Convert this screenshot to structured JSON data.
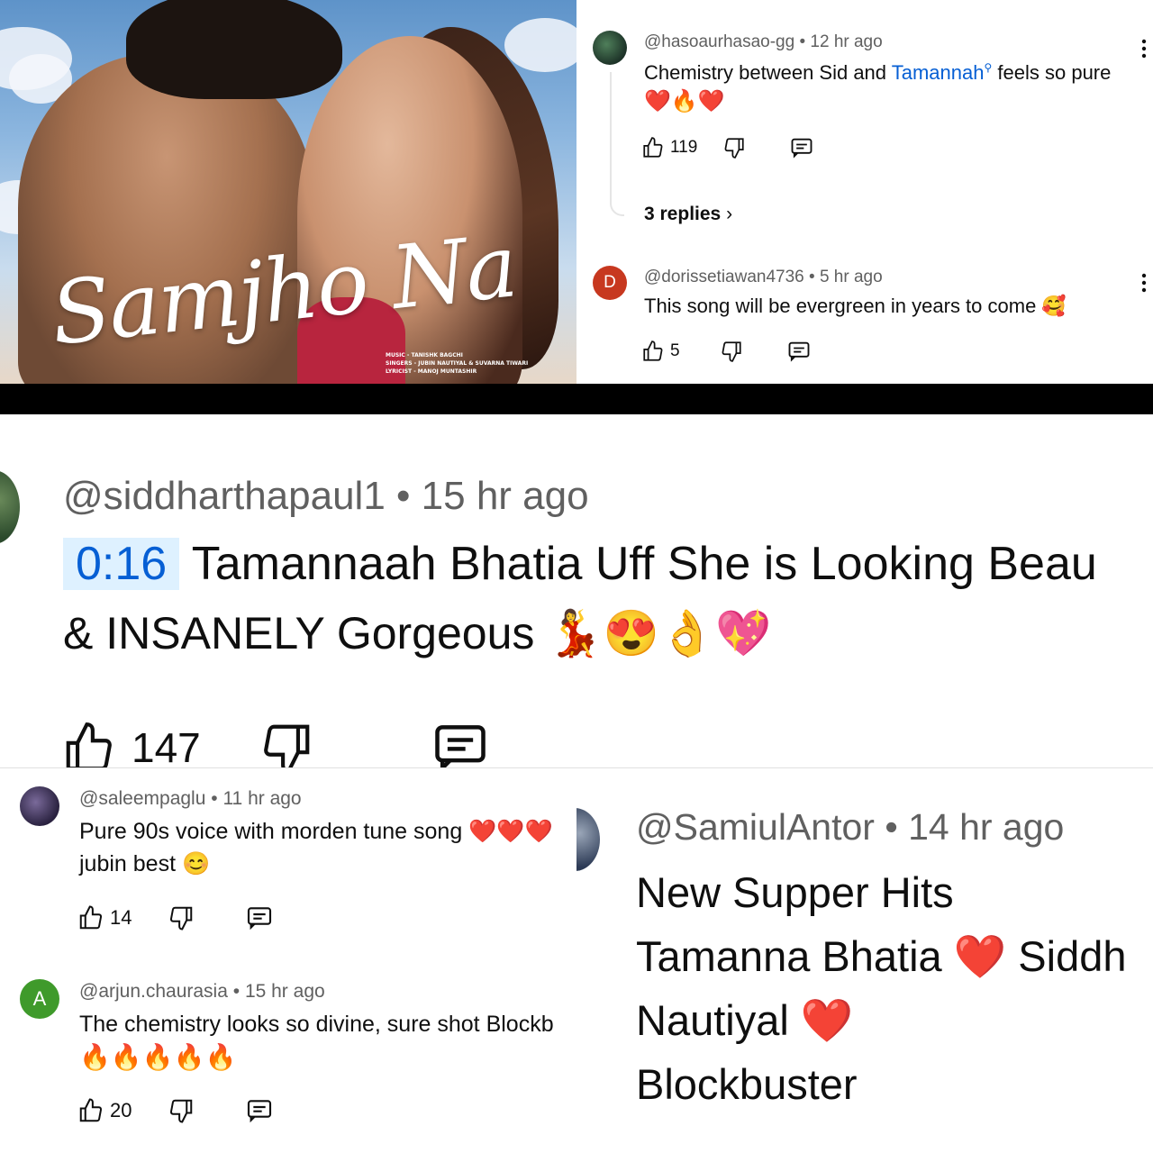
{
  "poster": {
    "title": "Samjho Na",
    "credits": [
      "MUSIC - TANISHK BAGCHI",
      "SINGERS - JUBIN NAUTIYAL & SUVARNA TIWARI",
      "LYRICIST - MANOJ MUNTASHIR"
    ]
  },
  "c1": {
    "user": "@hasoaurhasao-gg",
    "time": "12 hr ago",
    "text_a": "Chemistry between Sid and ",
    "link": "Tamannah",
    "text_b": " feels so pure",
    "emoji_line": "❤️🔥❤️",
    "likes": "119",
    "replies": "3 replies"
  },
  "c2": {
    "avatar_letter": "D",
    "user": "@dorissetiawan4736",
    "time": "5 hr ago",
    "text": "This song will be evergreen in years to come 🥰",
    "likes": "5"
  },
  "c3": {
    "user": "@siddharthapaul1",
    "time": "15 hr ago",
    "timestamp": "0:16",
    "text_a": "Tamannaah Bhatia Uff She is Looking Beau",
    "text_b": "& INSANELY Gorgeous 💃😍👌💖",
    "likes": "147"
  },
  "c4": {
    "user": "@saleempaglu",
    "time": "11 hr ago",
    "text_a": "Pure 90s voice with morden tune song ❤️❤️❤️",
    "text_b": "jubin best 😊",
    "likes": "14"
  },
  "c5": {
    "avatar_letter": "A",
    "user": "@arjun.chaurasia",
    "time": "15 hr ago",
    "text_a": "The chemistry looks so divine, sure shot Blockb",
    "text_b": "🔥🔥🔥🔥🔥",
    "likes": "20"
  },
  "c6": {
    "user": "@SamiulAntor",
    "time": "14 hr ago",
    "line1": "New Supper Hits",
    "line2": "Tamanna Bhatia ❤️ Siddh",
    "line3": "Nautiyal ❤️",
    "line4": "Blockbuster"
  },
  "colors": {
    "link": "#065fd4",
    "meta": "#606060",
    "avatar_d": "#c7381f",
    "avatar_a": "#3f9a2b",
    "timestamp_bg": "#def1ff"
  }
}
